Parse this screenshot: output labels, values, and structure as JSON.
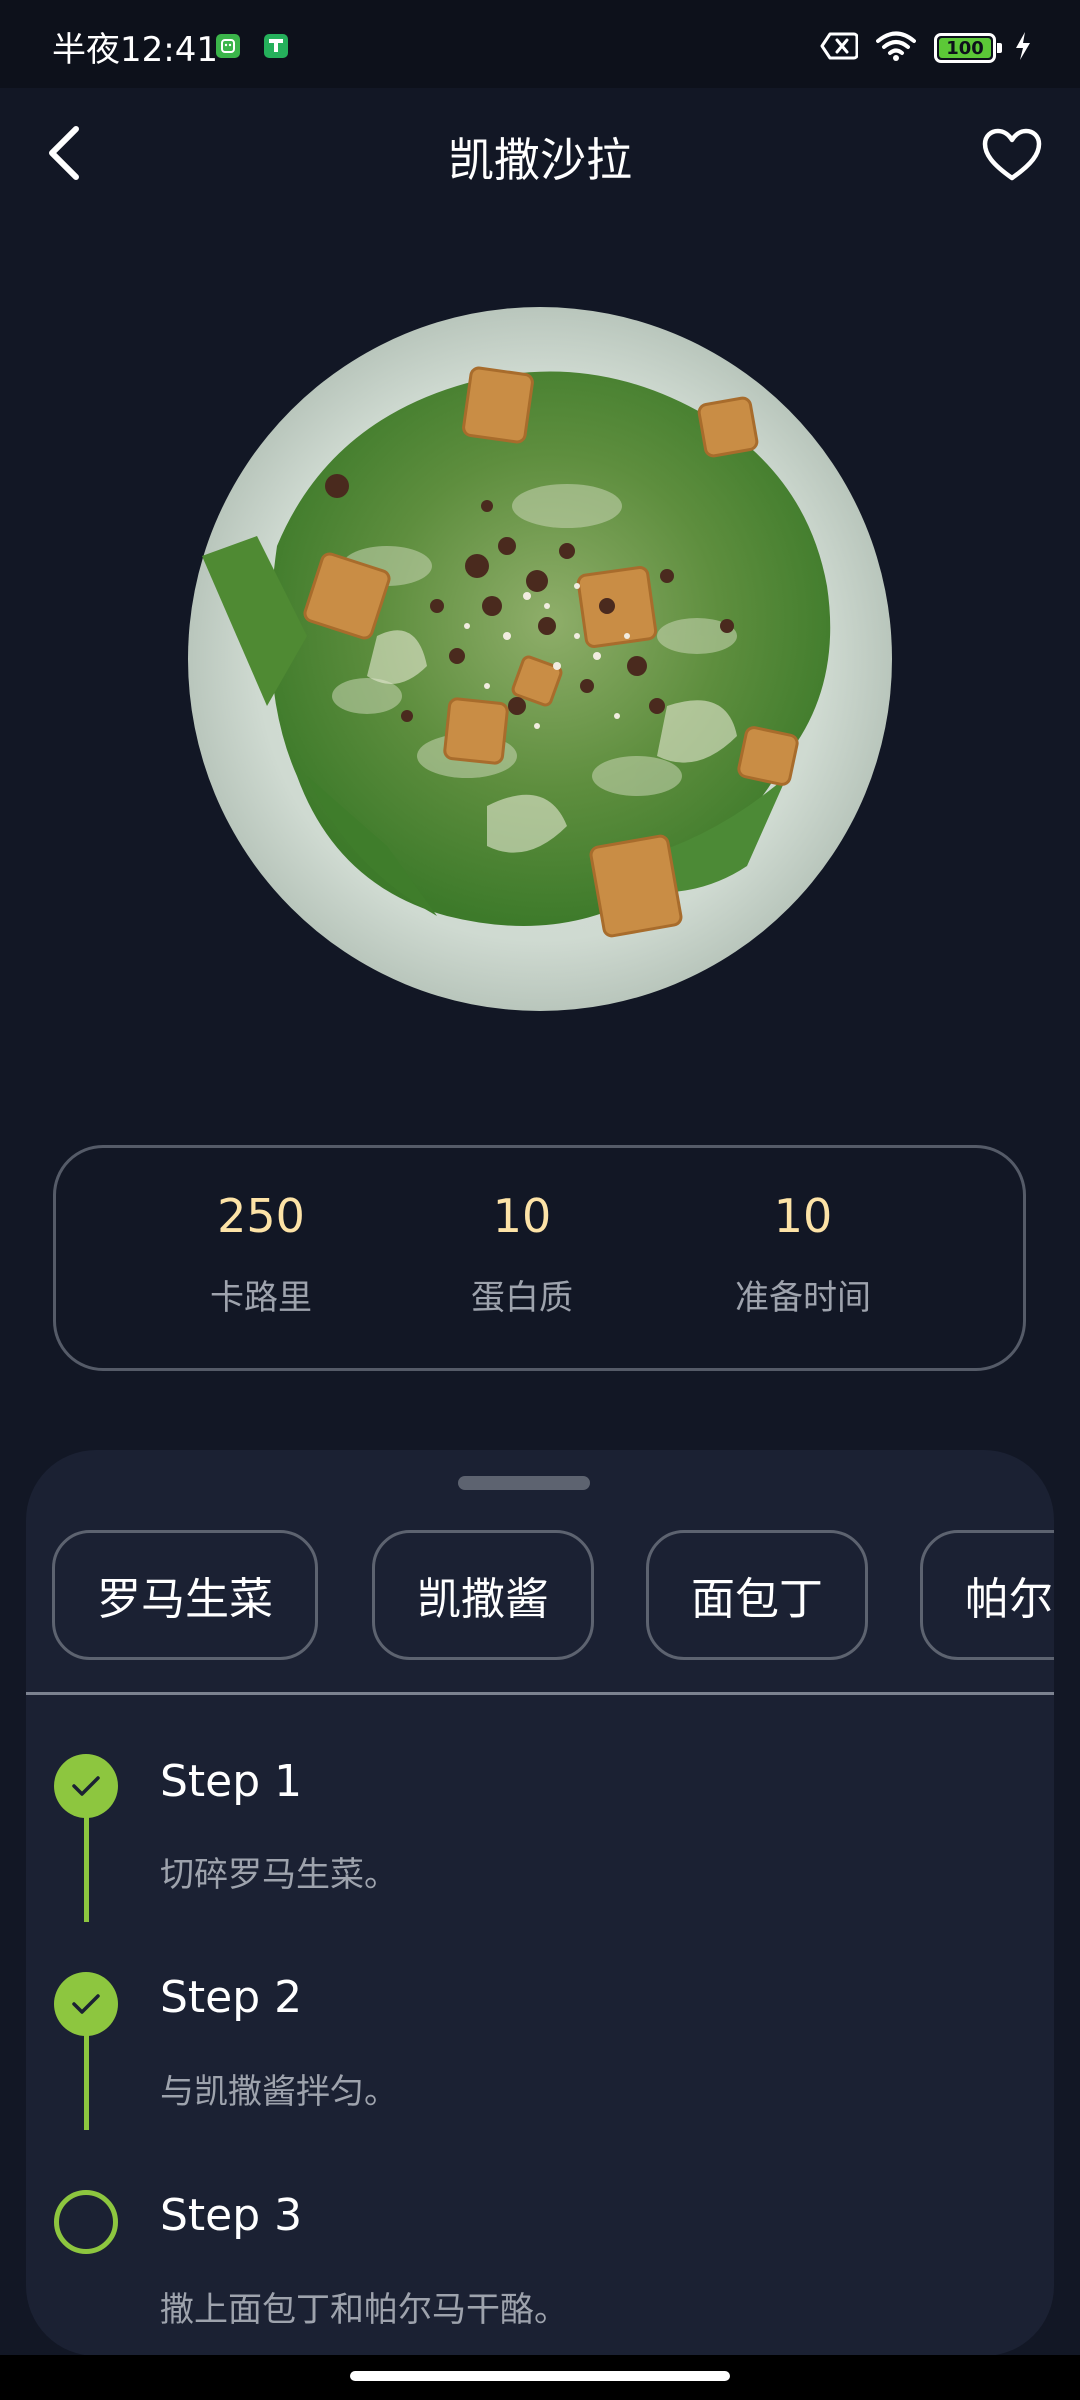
{
  "status_bar": {
    "time": "半夜12:41",
    "battery": "100",
    "icons": [
      "app-notification-icon",
      "app-store-icon",
      "no-sim-icon",
      "wifi-icon",
      "battery-icon",
      "charging-icon"
    ]
  },
  "header": {
    "title": "凯撒沙拉",
    "back_icon": "chevron-left-icon",
    "favorite_icon": "heart-outline-icon"
  },
  "stats": [
    {
      "value": "250",
      "label": "卡路里"
    },
    {
      "value": "10",
      "label": "蛋白质"
    },
    {
      "value": "10",
      "label": "准备时间"
    }
  ],
  "ingredients": [
    "罗马生菜",
    "凯撒酱",
    "面包丁",
    "帕尔"
  ],
  "steps": [
    {
      "title": "Step 1",
      "description": "切碎罗马生菜。",
      "completed": true
    },
    {
      "title": "Step 2",
      "description": "与凯撒酱拌匀。",
      "completed": true
    },
    {
      "title": "Step 3",
      "description": "撒上面包丁和帕尔马干酪。",
      "completed": false
    }
  ],
  "colors": {
    "background": "#121725",
    "sheet": "#1b2133",
    "accent": "#8dc63f",
    "stat_value": "#fde3a7",
    "muted_text": "#9ea3ad"
  }
}
